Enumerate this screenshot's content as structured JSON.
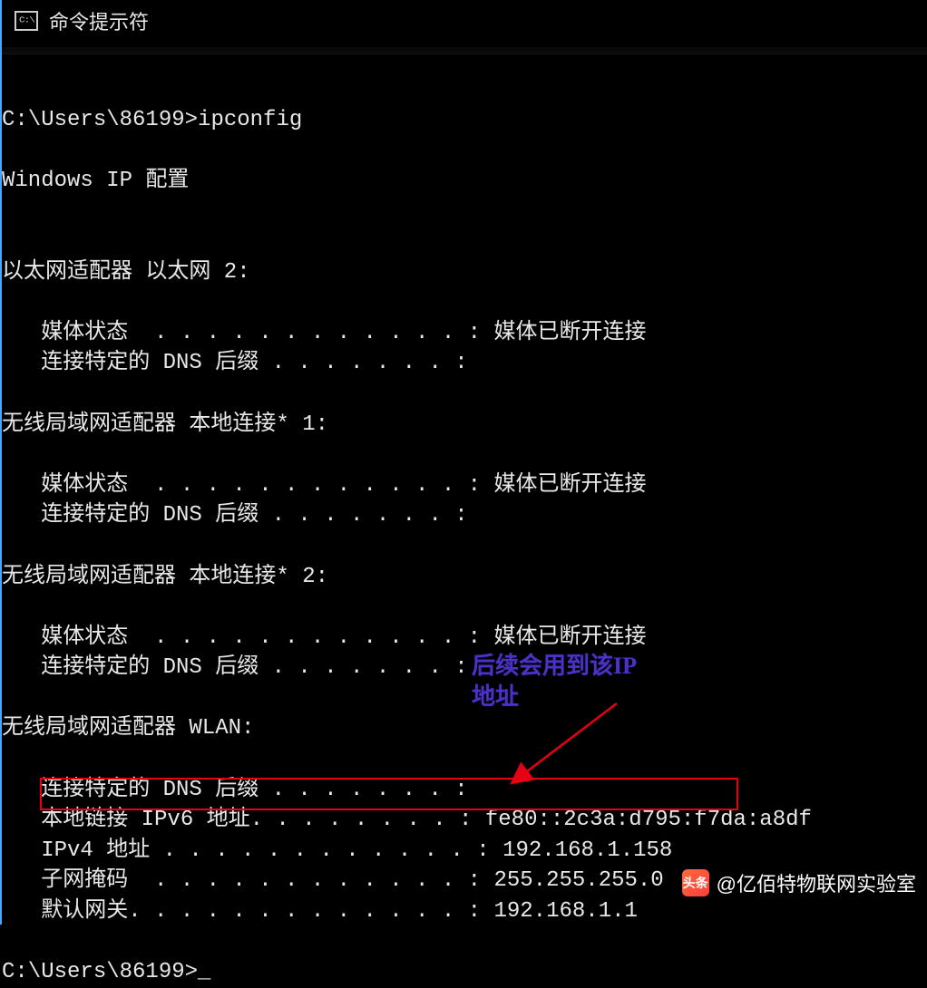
{
  "window": {
    "icon_text": "C:\\.",
    "title": "命令提示符"
  },
  "terminal": {
    "prompt1": "C:\\Users\\86199>",
    "command": "ipconfig",
    "header": "Windows IP 配置",
    "adapter1": {
      "title": "以太网适配器 以太网 2:",
      "line1": "   媒体状态  . . . . . . . . . . . . : 媒体已断开连接",
      "line2": "   连接特定的 DNS 后缀 . . . . . . . :"
    },
    "adapter2": {
      "title": "无线局域网适配器 本地连接* 1:",
      "line1": "   媒体状态  . . . . . . . . . . . . : 媒体已断开连接",
      "line2": "   连接特定的 DNS 后缀 . . . . . . . :"
    },
    "adapter3": {
      "title": "无线局域网适配器 本地连接* 2:",
      "line1": "   媒体状态  . . . . . . . . . . . . : 媒体已断开连接",
      "line2": "   连接特定的 DNS 后缀 . . . . . . . :"
    },
    "adapter4": {
      "title": "无线局域网适配器 WLAN:",
      "line1": "   连接特定的 DNS 后缀 . . . . . . . :",
      "line2": "   本地链接 IPv6 地址. . . . . . . . : fe80::2c3a:d795:f7da:a8df",
      "line3": "   IPv4 地址 . . . . . . . . . . . . : 192.168.1.158",
      "line4": "   子网掩码  . . . . . . . . . . . . : 255.255.255.0",
      "line5": "   默认网关. . . . . . . . . . . . . : 192.168.1.1"
    },
    "prompt2": "C:\\Users\\86199>",
    "cursor": "_"
  },
  "annotation": {
    "text_line1": "后续会用到该IP",
    "text_line2": "地址"
  },
  "watermark": {
    "logo_label": "头条",
    "text": "@亿佰特物联网实验室"
  }
}
